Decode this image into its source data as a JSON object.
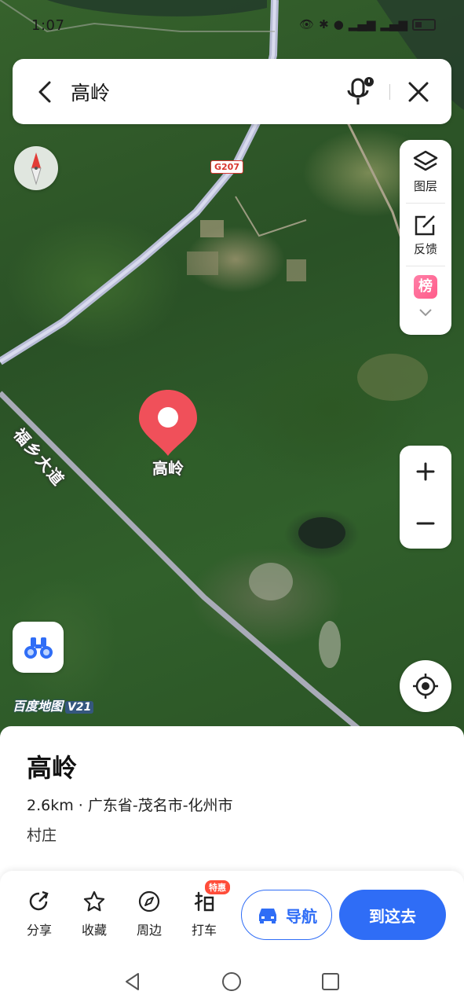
{
  "status_bar": {
    "time": "1:07"
  },
  "search": {
    "query": "高岭"
  },
  "map": {
    "road_shield": "G207",
    "road_label": "福乡大道",
    "pin_label": "高岭",
    "logo": "百度地图",
    "logo_version": "V21"
  },
  "tools": [
    {
      "label": "图层",
      "icon": "layers-icon"
    },
    {
      "label": "反馈",
      "icon": "feedback-icon"
    },
    {
      "label": "榜",
      "icon": "rank-icon"
    }
  ],
  "place": {
    "name": "高岭",
    "meta": "2.6km · 广东省-茂名市-化州市",
    "type": "村庄"
  },
  "actions": [
    {
      "label": "分享",
      "icon": "share-icon"
    },
    {
      "label": "收藏",
      "icon": "star-icon"
    },
    {
      "label": "周边",
      "icon": "compass-icon"
    },
    {
      "label": "打车",
      "icon": "taxi-icon",
      "badge": "特惠"
    }
  ],
  "nav_button": "导航",
  "go_button": "到这去",
  "colors": {
    "primary": "#2f6df6",
    "pin": "#f0505a",
    "badge": "#ff4d3a"
  }
}
